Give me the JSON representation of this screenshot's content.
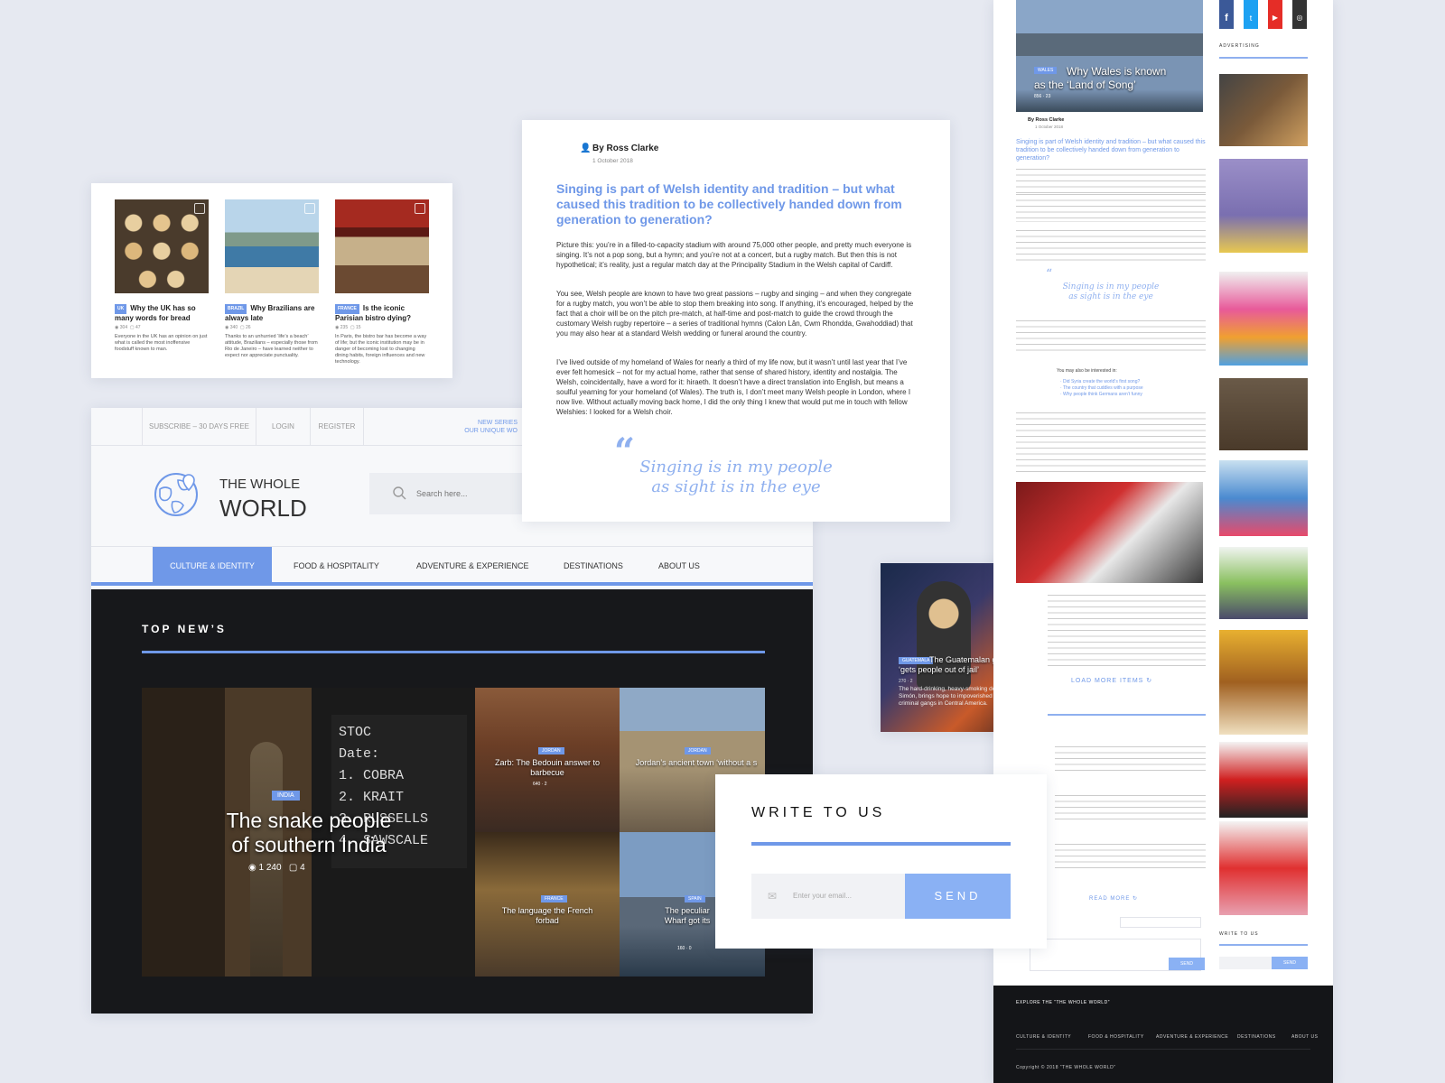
{
  "tiles": [
    {
      "tag": "UK",
      "title": "Why the UK has so many words for bread",
      "views": "304",
      "comments": "47",
      "desc": "Everyone in the UK has an opinion on just what is called the most inoffensive foodstuff known to man."
    },
    {
      "tag": "BRAZIL",
      "title": "Why Brazilians are always late",
      "views": "340",
      "comments": "26",
      "desc": "Thanks to an unhurried ‘life’s a beach’ attitude, Brazilians – especially those from Rio de Janeiro – have learned neither to expect nor appreciate punctuality."
    },
    {
      "tag": "FRANCE",
      "title": "Is the iconic Parisian bistro dying?",
      "views": "235",
      "comments": "15",
      "desc": "In Paris, the bistro bar has become a way of life; but the iconic institution may be in danger of becoming lost to changing dining habits, foreign influences and new technology."
    }
  ],
  "topbar": {
    "subscribe": "SUBSCRIBE – 30 DAYS FREE",
    "login": "LOGIN",
    "register": "REGISTER",
    "series1": "NEW SERIES",
    "series2": "OUR UNIQUE WO"
  },
  "logo": {
    "line1": "THE WHOLE",
    "line2": "WORLD"
  },
  "search": {
    "placeholder": "Search here..."
  },
  "nav": [
    "CULTURE & IDENTITY",
    "FOOD & HOSPITALITY",
    "ADVENTURE & EXPERIENCE",
    "DESTINATIONS",
    "ABOUT US"
  ],
  "top_news": {
    "heading": "TOP NEW’S",
    "hero": {
      "tag": "INDIA",
      "title1": "The snake people",
      "title2": "of southern India",
      "views": "1 240",
      "comments": "4"
    },
    "items": [
      {
        "tag": "JORDAN",
        "title": "Zarb: The Bedouin answer to barbecue",
        "views": "640",
        "comments": "2"
      },
      {
        "tag": "JORDAN",
        "title": "Jordan’s ancient town ‘without a s",
        "views": "",
        "comments": ""
      },
      {
        "tag": "FRANCE",
        "title": "The language the French forbad",
        "views": "",
        "comments": ""
      },
      {
        "tag": "SPAIN",
        "title": "The peculiar Wharf got its",
        "views": "160",
        "comments": "0"
      }
    ]
  },
  "article": {
    "author": "By Ross Clarke",
    "date": "1 October 2018",
    "lead": "Singing is part of Welsh identity and tradition – but what caused this tradition to be collectively handed down from generation to generation?",
    "p1": "Picture this: you’re in a filled-to-capacity stadium with around 75,000 other people, and pretty much everyone is singing. It’s not a pop song, but a hymn; and you’re not at a concert, but a rugby match. But then this is not hypothetical; it’s reality, just a regular match day at the Principality Stadium in the Welsh capital of Cardiff.",
    "p2": "You see, Welsh people are known to have two great passions – rugby and singing – and when they congregate for a rugby match, you won’t be able to stop them breaking into song. If anything, it’s encouraged, helped by the fact that a choir will be on the pitch pre-match, at half-time and post-match to guide the crowd through the customary Welsh rugby repertoire – a series of traditional hymns (Calon Lân, Cwm Rhondda, Gwahoddiad) that you may also hear at a standard Welsh wedding or funeral around the country.",
    "p3": "I’ve lived outside of my homeland of Wales for nearly a third of my life now, but it wasn’t until last year that I’ve ever felt homesick – not for my actual home, rather that sense of shared history, identity and nostalgia. The Welsh, coincidentally, have a word for it: hiraeth. It doesn’t have a direct translation into English, but means a soulful yearning for your homeland (of Wales). The truth is, I don’t meet many Welsh people in London, where I now live. Without actually moving back home, I did the only thing I knew that would put me in touch with fellow Welshies: I looked for a Welsh choir.",
    "quote1": "Singing is in my people",
    "quote2": "as sight is in the eye"
  },
  "write": {
    "heading": "WRITE TO US",
    "placeholder": "Enter your email...",
    "button": "SEND"
  },
  "guatemala": {
    "tag": "GUATEMALA",
    "title": "The Guatemalan god that ‘gets people out of jail’",
    "views": "270",
    "comments": "2",
    "desc": "The hard-drinking, heavy-smoking deity, San Simón, brings hope to impoverished citizens and criminal gangs in Central America."
  },
  "long": {
    "hero_tag": "WALES",
    "hero_title1": "Why Wales is known",
    "hero_title2": "as the ‘Land of Song’",
    "hero_views": "856",
    "hero_comments": "23",
    "author": "By Ross Clarke",
    "date": "1 October 2018",
    "lead": "Singing is part of Welsh identity and tradition – but what caused this tradition to be collectively handed down from generation to generation?",
    "quote1": "Singing is in my people",
    "quote2": "as sight is in the eye",
    "interested": "You may also be interested in:",
    "links": [
      "· Did Syria create the world’s first song?",
      "· The country that cuddles with a purpose",
      "· Why people think Germans aren’t funny"
    ],
    "load_more": "LOAD MORE ITEMS",
    "read_more": "READ MORE",
    "advertising": "ADVERTISING",
    "write_to_us": "WRITE TO US",
    "send": "SEND",
    "explore": "EXPLORE THE “THE WHOLE WORLD”",
    "footer_nav": [
      "CULTURE & IDENTITY",
      "FOOD & HOSPITALITY",
      "ADVENTURE & EXPERIENCE",
      "DESTINATIONS",
      "ABOUT US"
    ],
    "copyright": "Copyright © 2018 “THE WHOLE WORLD”"
  },
  "colors": {
    "accent": "#6f98e8",
    "dark": "#17181b",
    "bg": "#e6e9f1"
  }
}
